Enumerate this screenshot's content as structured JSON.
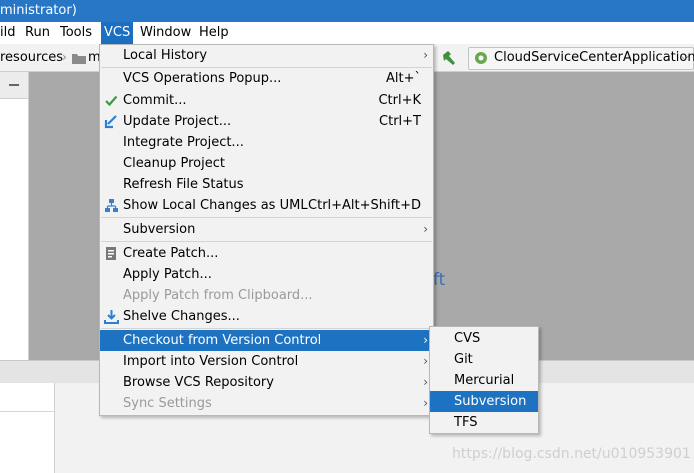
{
  "window": {
    "title_fragment": "ministrator)"
  },
  "menubar": {
    "items": [
      {
        "label": "ild"
      },
      {
        "label": "Run"
      },
      {
        "label": "Tools"
      },
      {
        "label": "VCS"
      },
      {
        "label": "Window"
      },
      {
        "label": "Help"
      }
    ]
  },
  "navbar": {
    "breadcrumb_1": "resources",
    "breadcrumb_2": "m",
    "run_config": "CloudServiceCenterApplication"
  },
  "editor": {
    "partial_text": "ft"
  },
  "vcs_menu": {
    "items": [
      {
        "label": "Local History",
        "shortcut": ""
      },
      {
        "label": "VCS Operations Popup...",
        "shortcut": "Alt+`"
      },
      {
        "label": "Commit...",
        "shortcut": "Ctrl+K"
      },
      {
        "label": "Update Project...",
        "shortcut": "Ctrl+T"
      },
      {
        "label": "Integrate Project...",
        "shortcut": ""
      },
      {
        "label": "Cleanup Project",
        "shortcut": ""
      },
      {
        "label": "Refresh File Status",
        "shortcut": ""
      },
      {
        "label": "Show Local Changes as UML",
        "shortcut": "Ctrl+Alt+Shift+D"
      },
      {
        "label": "Subversion",
        "shortcut": ""
      },
      {
        "label": "Create Patch...",
        "shortcut": ""
      },
      {
        "label": "Apply Patch...",
        "shortcut": ""
      },
      {
        "label": "Apply Patch from Clipboard...",
        "shortcut": ""
      },
      {
        "label": "Shelve Changes...",
        "shortcut": ""
      },
      {
        "label": "Checkout from Version Control",
        "shortcut": ""
      },
      {
        "label": "Import into Version Control",
        "shortcut": ""
      },
      {
        "label": "Browse VCS Repository",
        "shortcut": ""
      },
      {
        "label": "Sync Settings",
        "shortcut": ""
      }
    ]
  },
  "checkout_submenu": {
    "items": [
      {
        "label": "CVS"
      },
      {
        "label": "Git"
      },
      {
        "label": "Mercurial"
      },
      {
        "label": "Subversion"
      },
      {
        "label": "TFS"
      }
    ]
  },
  "watermark": "https://blog.csdn.net/u010953901",
  "colors": {
    "accent": "#1d72c2",
    "titlebar": "#2877c6",
    "editor_bg": "#a9a9a9"
  },
  "icons": [
    "check-icon",
    "update-arrow-icon",
    "uml-icon",
    "patch-icon",
    "shelve-icon",
    "hammer-icon",
    "run-config-icon",
    "folder-icon"
  ]
}
